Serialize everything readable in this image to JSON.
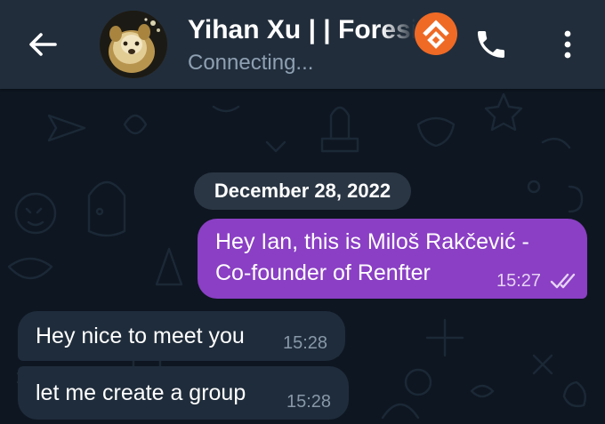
{
  "header": {
    "title": "Yihan Xu | | Foresi",
    "status": "Connecting..."
  },
  "chat": {
    "date_separator": "December 28, 2022",
    "messages": [
      {
        "direction": "outgoing",
        "lines": [
          "Hey Ian, this is Miloš Rakčević -",
          "Co-founder of Renfter"
        ],
        "time": "15:27",
        "status": "read"
      },
      {
        "direction": "incoming",
        "text": "Hey nice to meet you",
        "time": "15:28"
      },
      {
        "direction": "incoming",
        "text": "let me create a group",
        "time": "15:28"
      }
    ]
  },
  "colors": {
    "header_bg": "#212d3b",
    "chat_bg": "#0e1621",
    "outgoing_bubble": "#8a3fc4",
    "incoming_bubble": "#1f2c3b",
    "brand_badge": "#ef6a25"
  }
}
